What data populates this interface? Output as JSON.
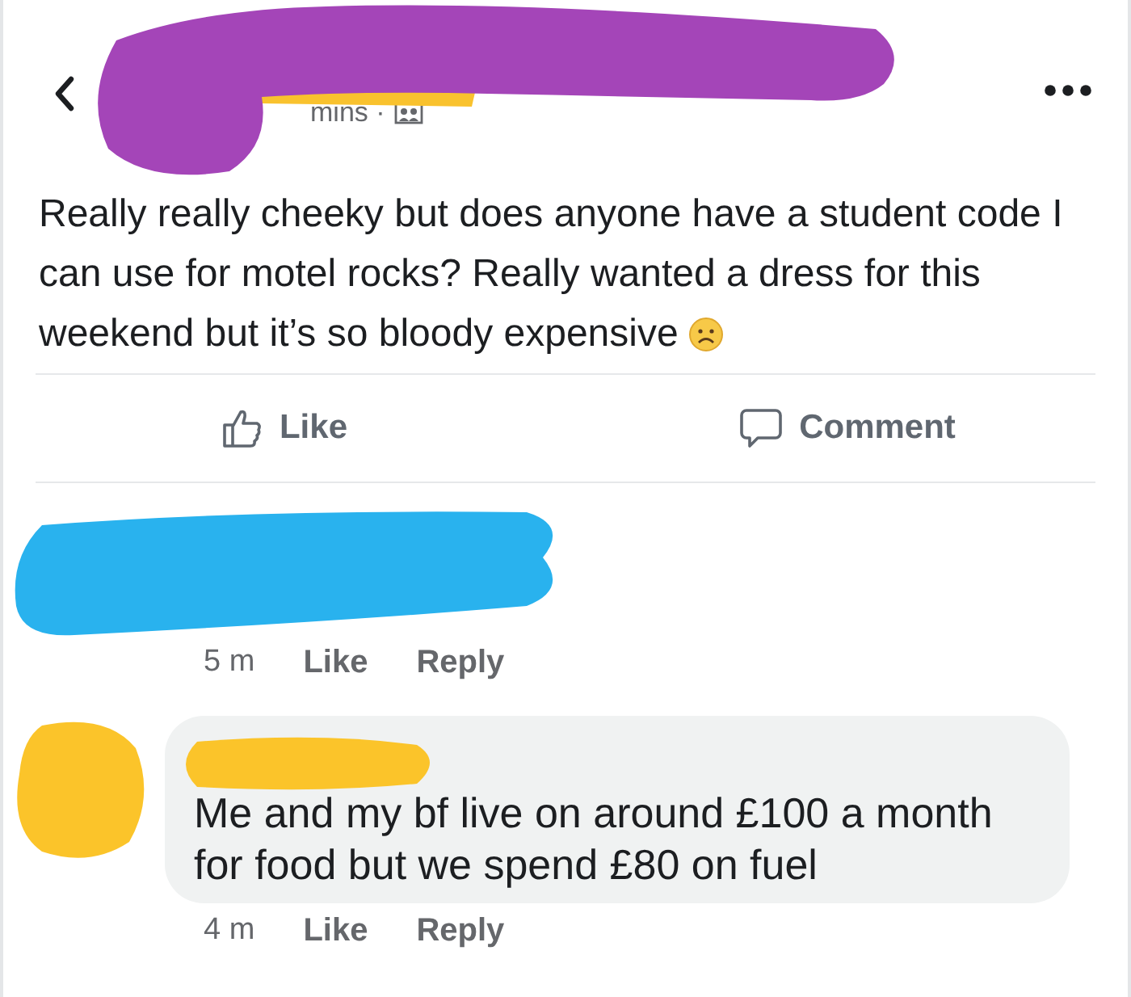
{
  "header": {
    "time": "mins ·"
  },
  "post": {
    "text": "Really really cheeky but does anyone have a student code I can use for motel rocks? Really wanted a dress for this weekend but it’s so bloody expensive"
  },
  "actions": [
    {
      "kind": "like",
      "label": "Like"
    },
    {
      "kind": "comment",
      "label": "Comment"
    }
  ],
  "comments": [
    {
      "kind": "covered",
      "time": "5 m",
      "actions": [
        "Like",
        "Reply"
      ]
    },
    {
      "kind": "bubble",
      "text": "Me and my bf live on around £100 a month for food but we spend £80 on fuel",
      "time": "4 m",
      "actions": [
        "Like",
        "Reply"
      ]
    }
  ]
}
